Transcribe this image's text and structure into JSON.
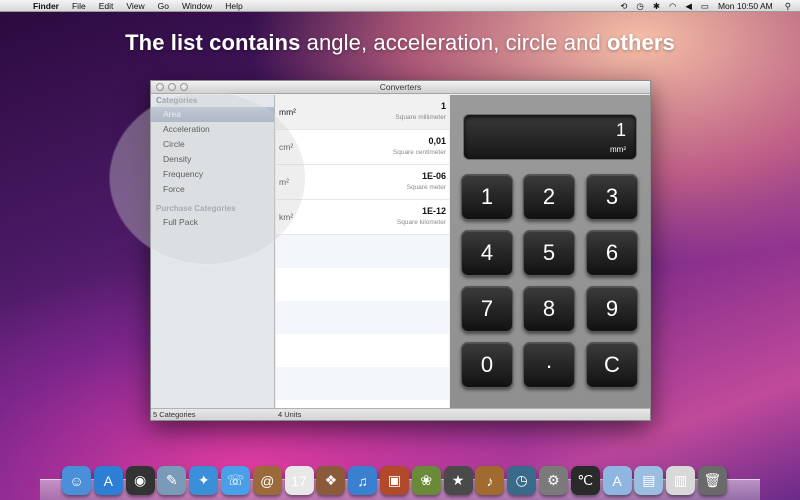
{
  "menubar": {
    "apple": "",
    "menus": [
      "Finder",
      "File",
      "Edit",
      "View",
      "Go",
      "Window",
      "Help"
    ],
    "status_icons": [
      "sync-icon",
      "clock-icon",
      "bluetooth-icon",
      "wifi-icon",
      "volume-icon",
      "battery-icon",
      "search-icon"
    ],
    "clock": "Mon 10:50 AM"
  },
  "headline": {
    "bold1": "The list contains",
    "normal": " angle, acceleration, circle and ",
    "bold2": "others"
  },
  "window": {
    "title": "Converters",
    "sidebar": {
      "categories_header": "Categories",
      "categories": [
        "Area",
        "Acceleration",
        "Circle",
        "Density",
        "Frequency",
        "Force"
      ],
      "selected_category": "Area",
      "purchase_header": "Purchase Categories",
      "purchase_items": [
        "Full Pack"
      ]
    },
    "units": [
      {
        "symbol": "mm²",
        "value": "1",
        "name": "Square millimeter"
      },
      {
        "symbol": "cm²",
        "value": "0,01",
        "name": "Square centimeter"
      },
      {
        "symbol": "m²",
        "value": "1E-06",
        "name": "Square meter"
      },
      {
        "symbol": "km²",
        "value": "1E-12",
        "name": "Square kilometer"
      }
    ],
    "status_left": "5 Categories",
    "status_mid": "4 Units",
    "calculator": {
      "display_value": "1",
      "display_unit": "mm²",
      "keys": [
        "1",
        "2",
        "3",
        "4",
        "5",
        "6",
        "7",
        "8",
        "9",
        "0",
        ".",
        "C"
      ]
    }
  },
  "dock": {
    "icons": [
      {
        "name": "finder-icon",
        "color": "#4a8fd8",
        "glyph": "☺"
      },
      {
        "name": "app-store-icon",
        "color": "#2d7fd6",
        "glyph": "A"
      },
      {
        "name": "dashboard-icon",
        "color": "#333333",
        "glyph": "◉"
      },
      {
        "name": "preview-icon",
        "color": "#7a9bb8",
        "glyph": "✎"
      },
      {
        "name": "safari-icon",
        "color": "#3b8fd9",
        "glyph": "✦"
      },
      {
        "name": "ichat-icon",
        "color": "#4aa0e8",
        "glyph": "☏"
      },
      {
        "name": "address-book-icon",
        "color": "#9b6a3a",
        "glyph": "@"
      },
      {
        "name": "ical-icon",
        "color": "#e8e8e8",
        "glyph": "17"
      },
      {
        "name": "photo-booth-icon",
        "color": "#8a5a3a",
        "glyph": "❖"
      },
      {
        "name": "itunes-icon",
        "color": "#3a7fd0",
        "glyph": "♫"
      },
      {
        "name": "photo-icon",
        "color": "#b04a2a",
        "glyph": "▣"
      },
      {
        "name": "iphoto-icon",
        "color": "#6a8a3a",
        "glyph": "❀"
      },
      {
        "name": "imovie-icon",
        "color": "#4a4a4a",
        "glyph": "★"
      },
      {
        "name": "garageband-icon",
        "color": "#a06a30",
        "glyph": "♪"
      },
      {
        "name": "time-machine-icon",
        "color": "#3a6a8a",
        "glyph": "◷"
      },
      {
        "name": "system-preferences-icon",
        "color": "#7a7a7a",
        "glyph": "⚙"
      },
      {
        "name": "converter-app-icon",
        "color": "#2a2a2a",
        "glyph": "℃"
      },
      {
        "name": "applications-folder-icon",
        "color": "#8fb6e0",
        "glyph": "A"
      },
      {
        "name": "documents-folder-icon",
        "color": "#9bbde0",
        "glyph": "▤"
      },
      {
        "name": "downloads-stack-icon",
        "color": "#d8d8d8",
        "glyph": "▥"
      },
      {
        "name": "trash-icon",
        "color": "#6a6a6a",
        "glyph": "🗑"
      }
    ]
  },
  "colors": {
    "selection": "#9dadc1",
    "calculator_panel": "#959595",
    "key": "#1f1f1f"
  }
}
